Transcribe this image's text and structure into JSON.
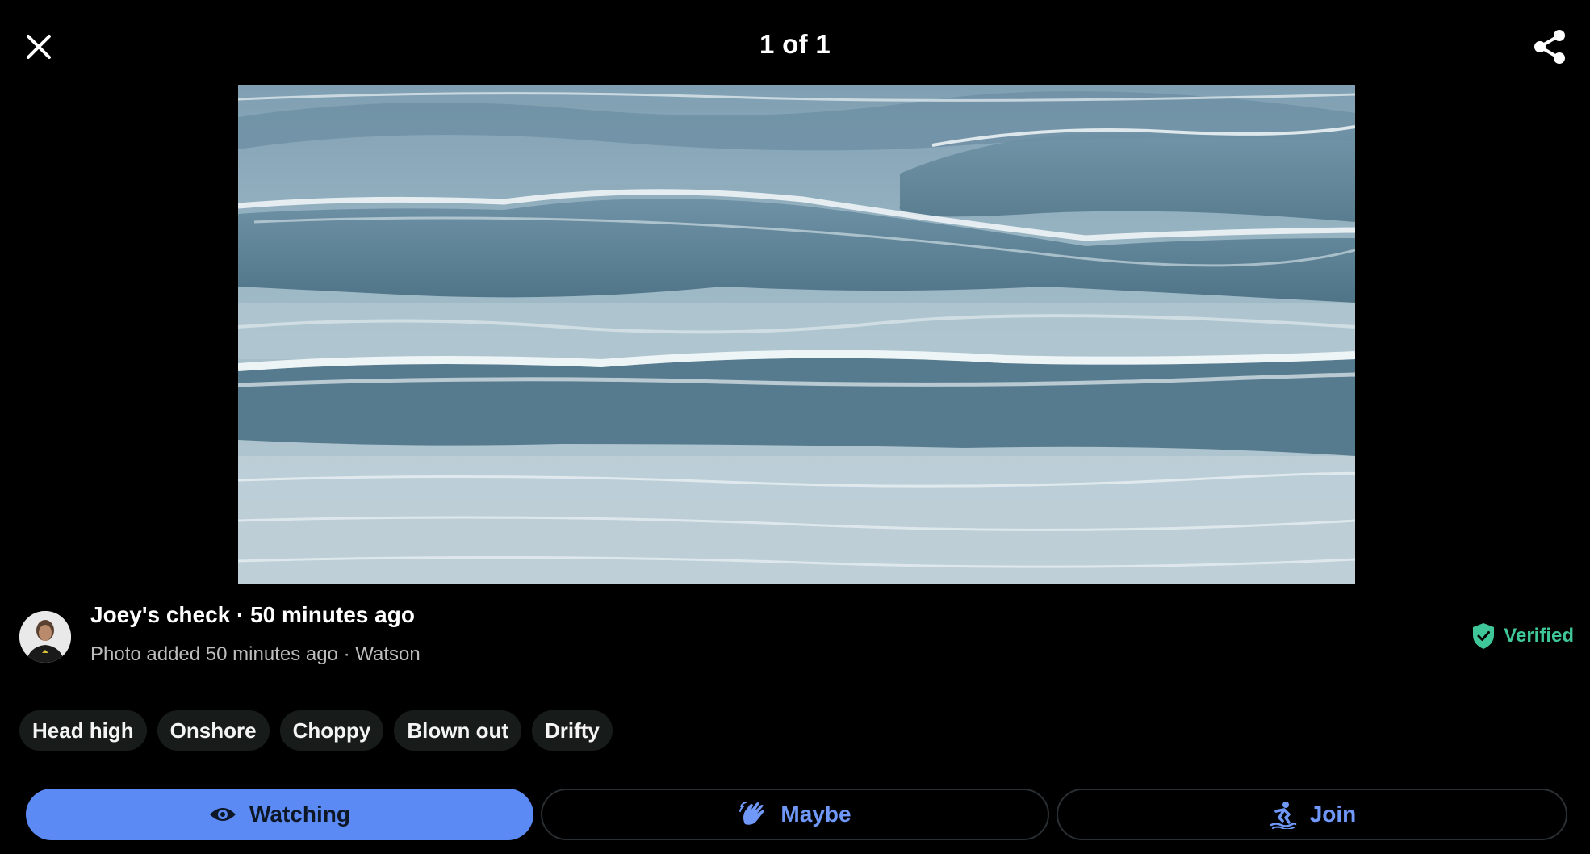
{
  "header": {
    "title": "1 of 1",
    "close_icon": "close-icon",
    "share_icon": "share-icon"
  },
  "photo": {
    "subject": "surf-waves-photo"
  },
  "check": {
    "title": "Joey's check · 50 minutes ago",
    "subtitle": "Photo added 50 minutes ago · Watson",
    "verified_label": "Verified",
    "verified_color": "#3fc79a"
  },
  "tags": [
    "Head high",
    "Onshore",
    "Choppy",
    "Blown out",
    "Drifty"
  ],
  "actions": {
    "watching_label": "Watching",
    "maybe_label": "Maybe",
    "join_label": "Join",
    "accent_color": "#5b8af5"
  }
}
